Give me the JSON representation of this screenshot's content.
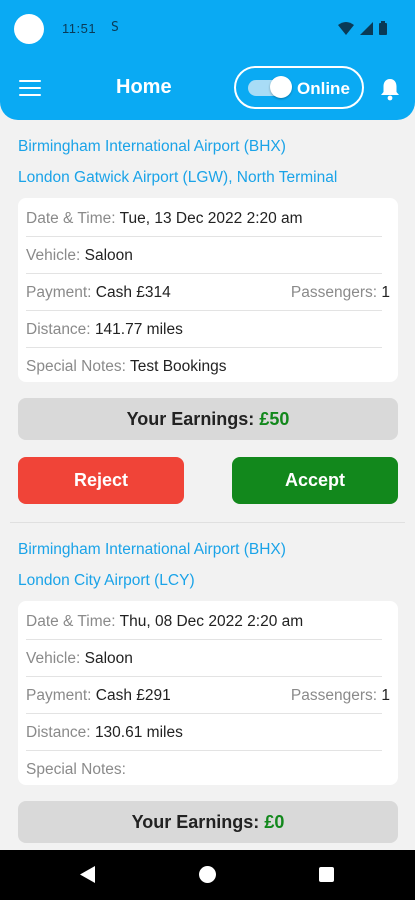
{
  "status_bar": {
    "time": "11:51",
    "sim_indicator": "S"
  },
  "app_bar": {
    "title": "Home",
    "online_label": "Online",
    "online_toggle_on": true
  },
  "bookings": [
    {
      "pickup": "Birmingham International Airport (BHX)",
      "dropoff": "London Gatwick Airport (LGW), North Terminal",
      "datetime_label": "Date & Time:",
      "datetime_value": "Tue, 13 Dec 2022 2:20 am",
      "vehicle_label": "Vehicle:",
      "vehicle_value": "Saloon",
      "payment_label": "Payment:",
      "payment_value": "Cash £314",
      "passengers_label": "Passengers:",
      "passengers_value": "1",
      "distance_label": "Distance:",
      "distance_value": "141.77 miles",
      "notes_label": "Special Notes:",
      "notes_value": "Test Bookings",
      "earnings_label": "Your Earnings:",
      "earnings_value": "£50",
      "reject_label": "Reject",
      "accept_label": "Accept"
    },
    {
      "pickup": "Birmingham International Airport (BHX)",
      "dropoff": "London City Airport (LCY)",
      "datetime_label": "Date & Time:",
      "datetime_value": "Thu, 08 Dec 2022 2:20 am",
      "vehicle_label": "Vehicle:",
      "vehicle_value": "Saloon",
      "payment_label": "Payment:",
      "payment_value": "Cash £291",
      "passengers_label": "Passengers:",
      "passengers_value": "1",
      "distance_label": "Distance:",
      "distance_value": "130.61 miles",
      "notes_label": "Special Notes:",
      "notes_value": "",
      "earnings_label": "Your Earnings:",
      "earnings_value": "£0"
    }
  ],
  "icons": {
    "menu": "hamburger-menu-icon",
    "bell": "bell-icon",
    "wifi": "wifi-icon",
    "signal": "signal-icon",
    "battery": "battery-icon",
    "back": "back-triangle-icon",
    "home": "home-circle-icon",
    "recent": "recent-apps-square-icon"
  },
  "colors": {
    "header": "#0aaaf3",
    "link": "#1aa3e8",
    "reject": "#f04438",
    "accept": "#12881c",
    "earnings_amount": "#12881c"
  }
}
